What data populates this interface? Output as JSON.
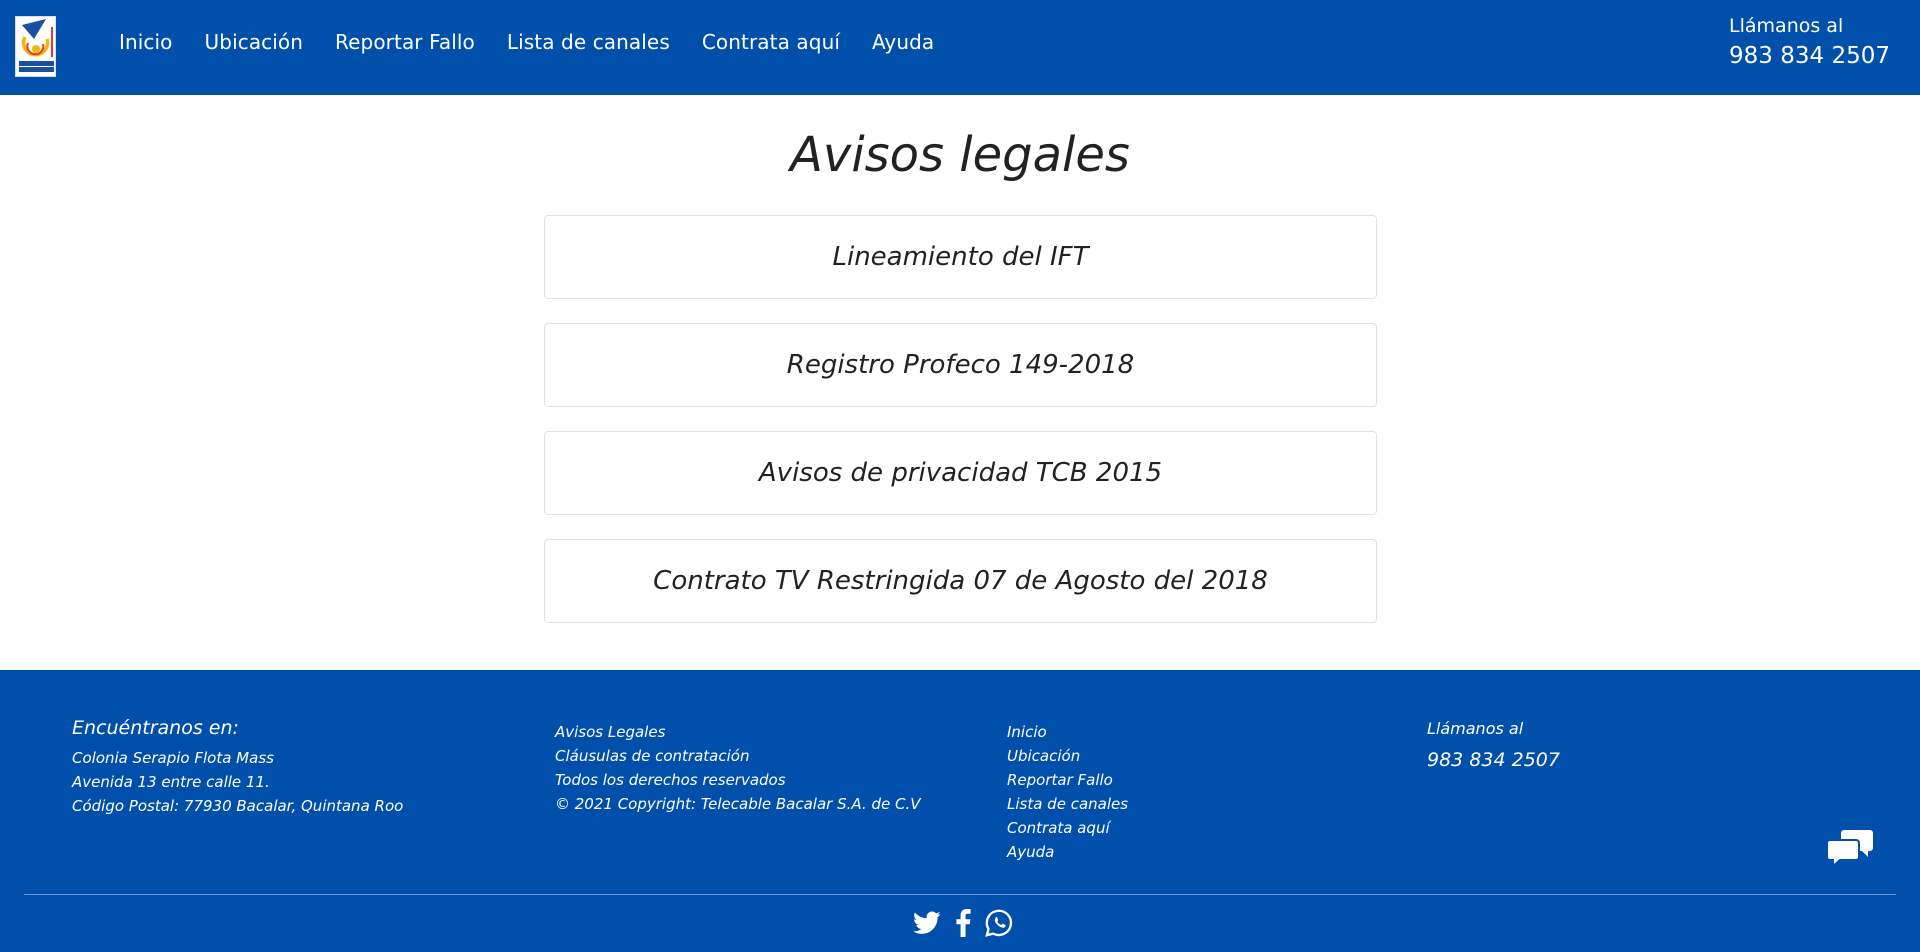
{
  "colors": {
    "brand_blue": "#0050ab",
    "text_dark": "#222222",
    "card_border": "#e0e2e6"
  },
  "header": {
    "logo_icon": "telecable-bacalar-logo-icon",
    "nav": [
      "Inicio",
      "Ubicación",
      "Reportar Fallo",
      "Lista de canales",
      "Contrata aquí",
      "Ayuda"
    ],
    "call_label": "Llámanos al",
    "call_number": "983 834 2507"
  },
  "main": {
    "title": "Avisos legales",
    "documents": [
      "Lineamiento del IFT",
      "Registro Profeco 149-2018",
      "Avisos de privacidad TCB 2015",
      "Contrato TV Restringida 07 de Agosto del 2018"
    ]
  },
  "footer": {
    "location": {
      "heading": "Encuéntranos en:",
      "lines": [
        "Colonia Serapio Flota Mass",
        "Avenida 13 entre calle 11.",
        "Código Postal: 77930 Bacalar, Quintana Roo"
      ]
    },
    "legal": [
      "Avisos Legales",
      "Cláusulas de contratación",
      "Todos los derechos reservados",
      "© 2021 Copyright: Telecable Bacalar S.A. de C.V"
    ],
    "links": [
      "Inicio",
      "Ubicación",
      "Reportar Fallo",
      "Lista de canales",
      "Contrata aquí",
      "Ayuda"
    ],
    "call_label": "Llámanos al",
    "call_number": "983 834 2507",
    "chat_icon": "chat-bubbles-icon",
    "social_icons": [
      "twitter-icon",
      "facebook-icon",
      "whatsapp-icon"
    ]
  }
}
